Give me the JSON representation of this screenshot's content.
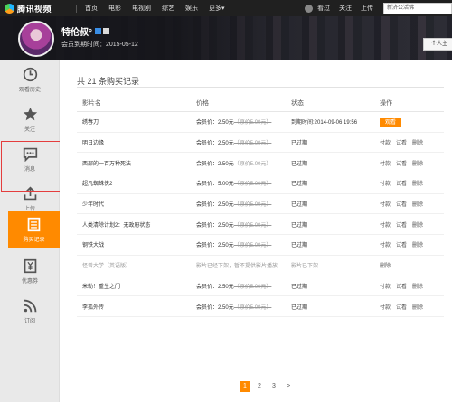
{
  "app": {
    "logo_text": "腾讯视频"
  },
  "nav": {
    "items": [
      "首页",
      "电影",
      "电视剧",
      "综艺",
      "娱乐",
      "更多"
    ],
    "more_suffix": "▾",
    "history": "看过",
    "follow": "关注",
    "upload": "上传",
    "search_value": "新济公活佛"
  },
  "profile": {
    "username": "特伦叔°",
    "expire_text": "会员到期时间：2015-05-12",
    "home_button": "个人主"
  },
  "sidebar": {
    "items": [
      {
        "label": "观看历史",
        "icon": "clock-icon"
      },
      {
        "label": "关注",
        "icon": "star-icon"
      },
      {
        "label": "消息",
        "icon": "message-icon"
      },
      {
        "label": "上传",
        "icon": "upload-icon"
      },
      {
        "label": "购买记录",
        "icon": "purchase-list-icon",
        "active": true
      },
      {
        "label": "优惠券",
        "icon": "coupon-icon"
      },
      {
        "label": "订阅",
        "icon": "rss-icon"
      }
    ]
  },
  "main": {
    "count_title": "共 21 条购买记录",
    "headers": {
      "name": "影片名",
      "price": "价格",
      "status": "状态",
      "op": "操作"
    },
    "rows": [
      {
        "name": "绣春刀",
        "price_prefix": "会员价：2.50元",
        "orig": "（原价5.00元）",
        "status": "到期时间:2014-09-06 19:56",
        "op_type": "buy",
        "buy": "观看"
      },
      {
        "name": "明日边缘",
        "price_prefix": "会员价：2.50元",
        "orig": "（原价5.00元）",
        "status": "已过期",
        "op_type": "links",
        "pay": "付款",
        "trial": "试看",
        "del": "删除"
      },
      {
        "name": "西部的一百万种死法",
        "price_prefix": "会员价：2.50元",
        "orig": "（原价5.00元）",
        "status": "已过期",
        "op_type": "links",
        "pay": "付款",
        "trial": "试看",
        "del": "删除"
      },
      {
        "name": "超凡蜘蛛侠2",
        "price_prefix": "会员价：5.00元",
        "orig": "（原价5.00元）",
        "status": "已过期",
        "op_type": "links",
        "pay": "付款",
        "trial": "试看",
        "del": "删除"
      },
      {
        "name": "少年时代",
        "price_prefix": "会员价：2.50元",
        "orig": "（原价5.00元）",
        "status": "已过期",
        "op_type": "links",
        "pay": "付款",
        "trial": "试看",
        "del": "删除"
      },
      {
        "name": "人类清除计划2：无政府状态",
        "price_prefix": "会员价：2.50元",
        "orig": "（原价5.00元）",
        "status": "已过期",
        "op_type": "links",
        "pay": "付款",
        "trial": "试看",
        "del": "删除"
      },
      {
        "name": "钢铁大战",
        "price_prefix": "会员价：2.50元",
        "orig": "（原价5.00元）",
        "status": "已过期",
        "op_type": "links",
        "pay": "付款",
        "trial": "试看",
        "del": "删除"
      },
      {
        "name": "怪兽大学（英语版）",
        "price_prefix": "影片已经下架，暂不提供影片播放",
        "orig": "",
        "status": "影片已下架",
        "op_type": "delete",
        "del": "删除",
        "gray": true
      },
      {
        "name": "米勒！重生之门",
        "price_prefix": "会员价：2.50元",
        "orig": "（原价5.00元）",
        "status": "已过期",
        "op_type": "links",
        "pay": "付款",
        "trial": "试看",
        "del": "删除"
      },
      {
        "name": "李孤外传",
        "price_prefix": "会员价：2.50元",
        "orig": "（原价5.00元）",
        "status": "已过期",
        "op_type": "links",
        "pay": "付款",
        "trial": "试看",
        "del": "删除"
      }
    ],
    "pagination": {
      "pages": [
        "1",
        "2",
        "3"
      ],
      "current": "1",
      "next": ">"
    }
  },
  "colors": {
    "accent": "#ff8a00",
    "topbar": "#202020",
    "highlight_outline": "#e43d3d"
  }
}
